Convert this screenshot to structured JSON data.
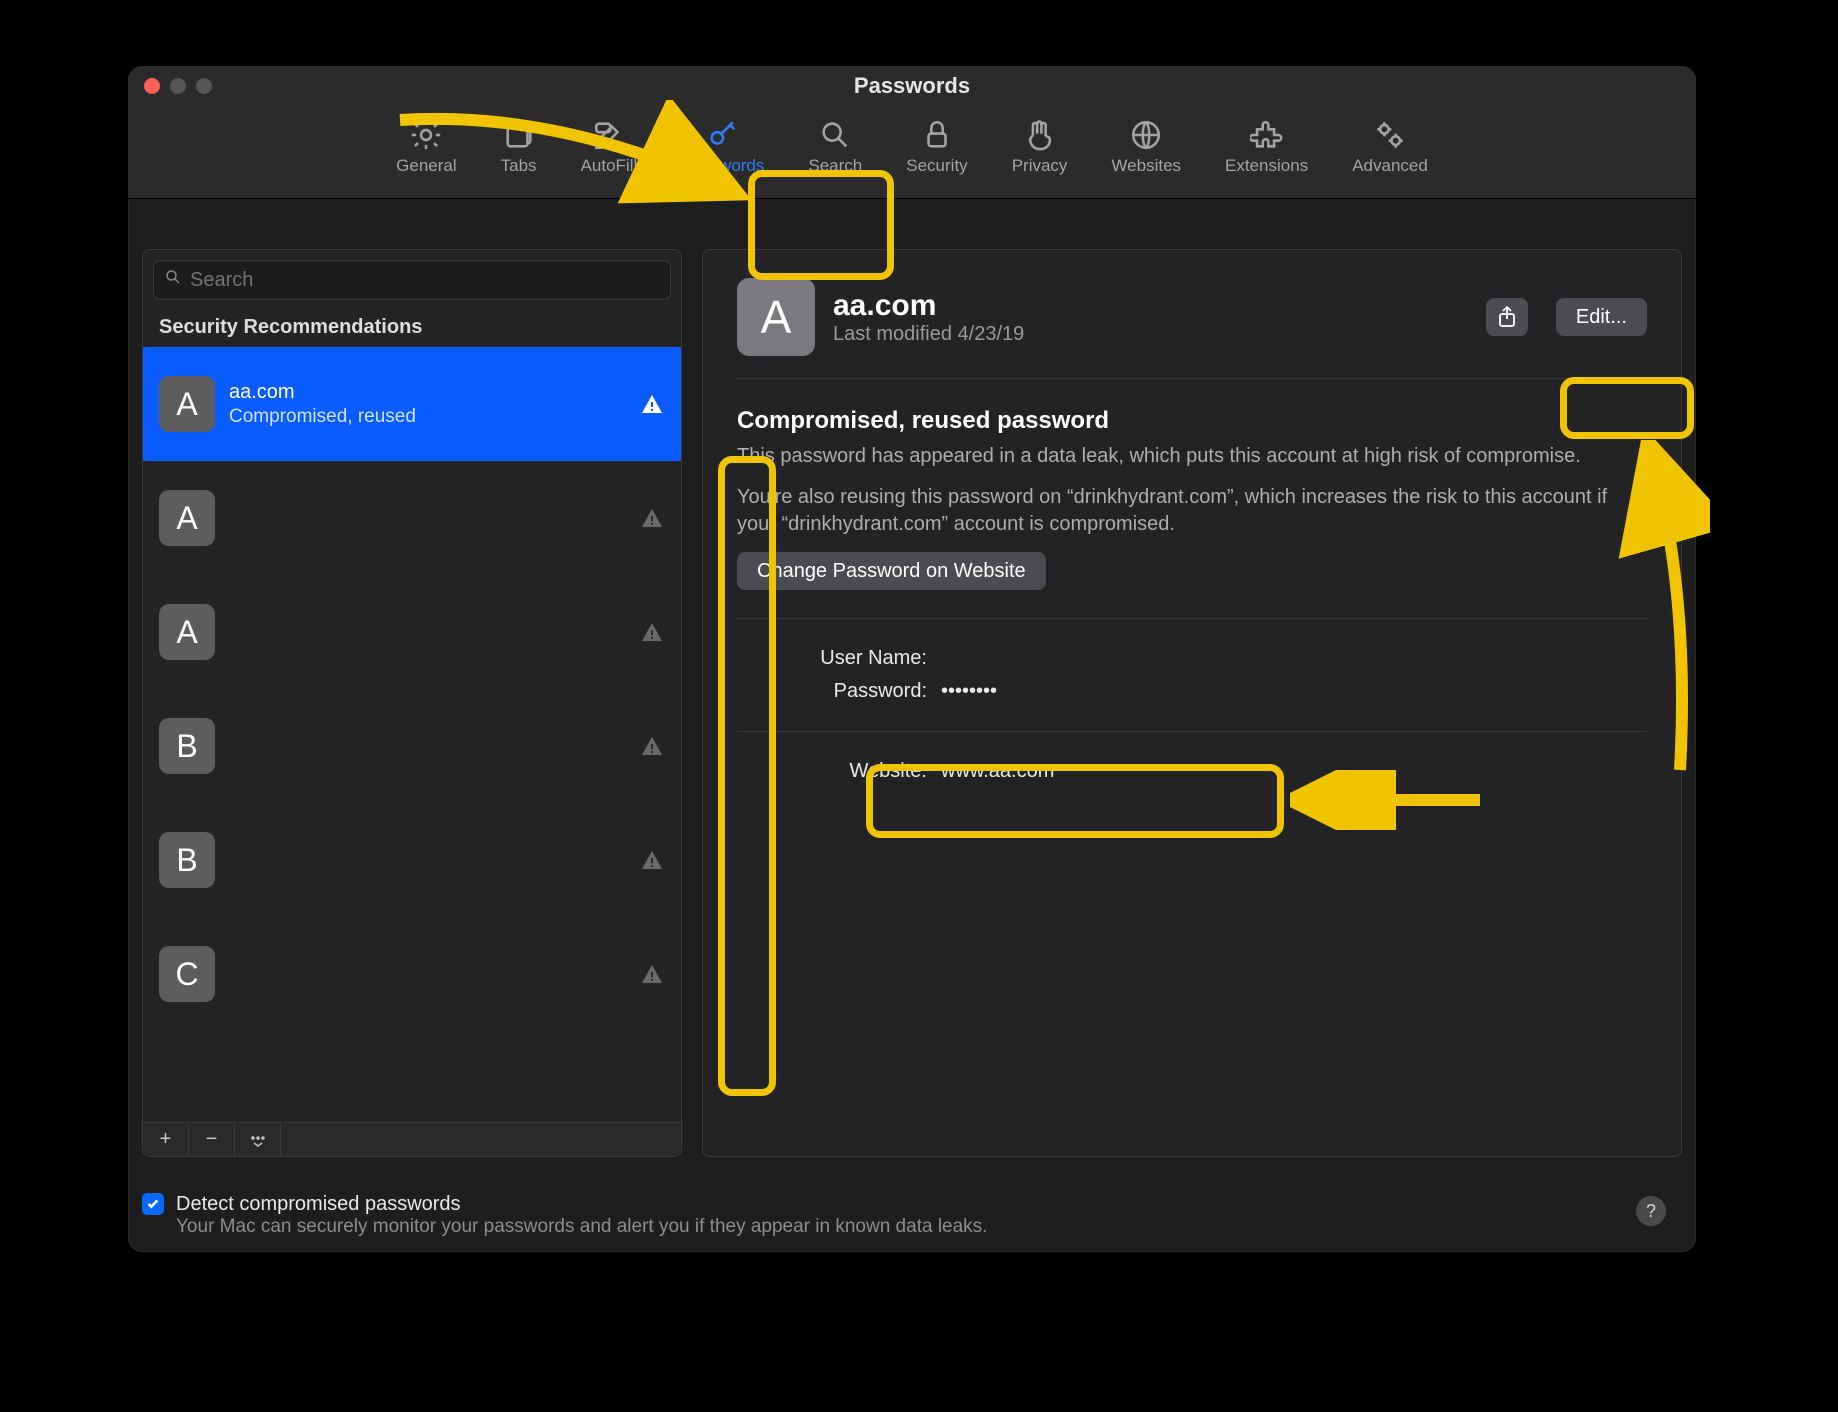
{
  "window_title": "Passwords",
  "toolbar": {
    "items": [
      {
        "label": "General"
      },
      {
        "label": "Tabs"
      },
      {
        "label": "AutoFill"
      },
      {
        "label": "Passwords"
      },
      {
        "label": "Search"
      },
      {
        "label": "Security"
      },
      {
        "label": "Privacy"
      },
      {
        "label": "Websites"
      },
      {
        "label": "Extensions"
      },
      {
        "label": "Advanced"
      }
    ]
  },
  "search": {
    "placeholder": "Search"
  },
  "sidebar": {
    "section": "Security Recommendations",
    "rows": [
      {
        "letter": "A",
        "domain": "aa.com",
        "status": "Compromised, reused",
        "selected": true,
        "warn_variant": "solid"
      },
      {
        "letter": "A",
        "domain": "",
        "status": "",
        "selected": false,
        "warn_variant": "muted"
      },
      {
        "letter": "A",
        "domain": "",
        "status": "",
        "selected": false,
        "warn_variant": "muted"
      },
      {
        "letter": "B",
        "domain": "",
        "status": "",
        "selected": false,
        "warn_variant": "muted"
      },
      {
        "letter": "B",
        "domain": "",
        "status": "",
        "selected": false,
        "warn_variant": "muted"
      },
      {
        "letter": "C",
        "domain": "",
        "status": "",
        "selected": false,
        "warn_variant": "muted"
      }
    ]
  },
  "detail": {
    "letter": "A",
    "title": "aa.com",
    "subtitle": "Last modified 4/23/19",
    "edit_label": "Edit...",
    "warning_heading": "Compromised, reused password",
    "warning_p1": "This password has appeared in a data leak, which puts this account at high risk of compromise.",
    "warning_p2": "You're also reusing this password on “drinkhydrant.com”, which increases the risk to this account if your “drinkhydrant.com” account is compromised.",
    "change_btn": "Change Password on Website",
    "fields": {
      "username_label": "User Name:",
      "username_value": "",
      "password_label": "Password:",
      "password_value": "••••••••",
      "website_label": "Website:",
      "website_value": "www.aa.com"
    }
  },
  "footer": {
    "checkbox_label": "Detect compromised passwords",
    "checkbox_sub": "Your Mac can securely monitor your passwords and alert you if they appear in known data leaks."
  }
}
